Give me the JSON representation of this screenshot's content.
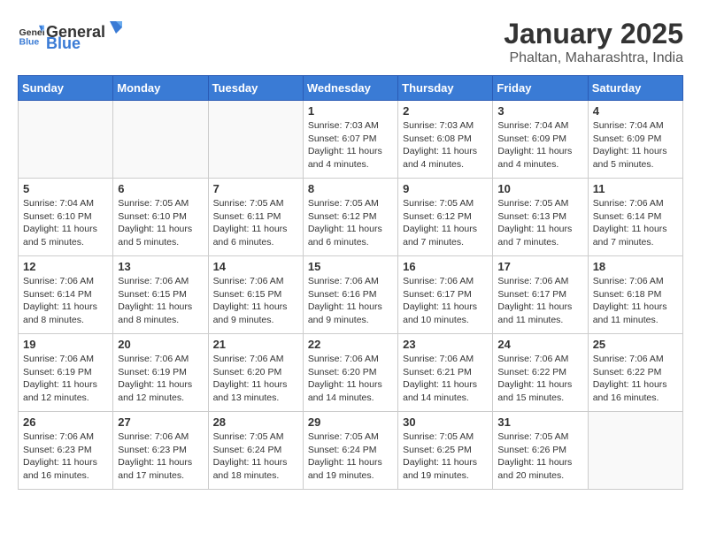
{
  "header": {
    "logo_general": "General",
    "logo_blue": "Blue",
    "month": "January 2025",
    "location": "Phaltan, Maharashtra, India"
  },
  "weekdays": [
    "Sunday",
    "Monday",
    "Tuesday",
    "Wednesday",
    "Thursday",
    "Friday",
    "Saturday"
  ],
  "weeks": [
    [
      {
        "day": "",
        "info": ""
      },
      {
        "day": "",
        "info": ""
      },
      {
        "day": "",
        "info": ""
      },
      {
        "day": "1",
        "info": "Sunrise: 7:03 AM\nSunset: 6:07 PM\nDaylight: 11 hours\nand 4 minutes."
      },
      {
        "day": "2",
        "info": "Sunrise: 7:03 AM\nSunset: 6:08 PM\nDaylight: 11 hours\nand 4 minutes."
      },
      {
        "day": "3",
        "info": "Sunrise: 7:04 AM\nSunset: 6:09 PM\nDaylight: 11 hours\nand 4 minutes."
      },
      {
        "day": "4",
        "info": "Sunrise: 7:04 AM\nSunset: 6:09 PM\nDaylight: 11 hours\nand 5 minutes."
      }
    ],
    [
      {
        "day": "5",
        "info": "Sunrise: 7:04 AM\nSunset: 6:10 PM\nDaylight: 11 hours\nand 5 minutes."
      },
      {
        "day": "6",
        "info": "Sunrise: 7:05 AM\nSunset: 6:10 PM\nDaylight: 11 hours\nand 5 minutes."
      },
      {
        "day": "7",
        "info": "Sunrise: 7:05 AM\nSunset: 6:11 PM\nDaylight: 11 hours\nand 6 minutes."
      },
      {
        "day": "8",
        "info": "Sunrise: 7:05 AM\nSunset: 6:12 PM\nDaylight: 11 hours\nand 6 minutes."
      },
      {
        "day": "9",
        "info": "Sunrise: 7:05 AM\nSunset: 6:12 PM\nDaylight: 11 hours\nand 7 minutes."
      },
      {
        "day": "10",
        "info": "Sunrise: 7:05 AM\nSunset: 6:13 PM\nDaylight: 11 hours\nand 7 minutes."
      },
      {
        "day": "11",
        "info": "Sunrise: 7:06 AM\nSunset: 6:14 PM\nDaylight: 11 hours\nand 7 minutes."
      }
    ],
    [
      {
        "day": "12",
        "info": "Sunrise: 7:06 AM\nSunset: 6:14 PM\nDaylight: 11 hours\nand 8 minutes."
      },
      {
        "day": "13",
        "info": "Sunrise: 7:06 AM\nSunset: 6:15 PM\nDaylight: 11 hours\nand 8 minutes."
      },
      {
        "day": "14",
        "info": "Sunrise: 7:06 AM\nSunset: 6:15 PM\nDaylight: 11 hours\nand 9 minutes."
      },
      {
        "day": "15",
        "info": "Sunrise: 7:06 AM\nSunset: 6:16 PM\nDaylight: 11 hours\nand 9 minutes."
      },
      {
        "day": "16",
        "info": "Sunrise: 7:06 AM\nSunset: 6:17 PM\nDaylight: 11 hours\nand 10 minutes."
      },
      {
        "day": "17",
        "info": "Sunrise: 7:06 AM\nSunset: 6:17 PM\nDaylight: 11 hours\nand 11 minutes."
      },
      {
        "day": "18",
        "info": "Sunrise: 7:06 AM\nSunset: 6:18 PM\nDaylight: 11 hours\nand 11 minutes."
      }
    ],
    [
      {
        "day": "19",
        "info": "Sunrise: 7:06 AM\nSunset: 6:19 PM\nDaylight: 11 hours\nand 12 minutes."
      },
      {
        "day": "20",
        "info": "Sunrise: 7:06 AM\nSunset: 6:19 PM\nDaylight: 11 hours\nand 12 minutes."
      },
      {
        "day": "21",
        "info": "Sunrise: 7:06 AM\nSunset: 6:20 PM\nDaylight: 11 hours\nand 13 minutes."
      },
      {
        "day": "22",
        "info": "Sunrise: 7:06 AM\nSunset: 6:20 PM\nDaylight: 11 hours\nand 14 minutes."
      },
      {
        "day": "23",
        "info": "Sunrise: 7:06 AM\nSunset: 6:21 PM\nDaylight: 11 hours\nand 14 minutes."
      },
      {
        "day": "24",
        "info": "Sunrise: 7:06 AM\nSunset: 6:22 PM\nDaylight: 11 hours\nand 15 minutes."
      },
      {
        "day": "25",
        "info": "Sunrise: 7:06 AM\nSunset: 6:22 PM\nDaylight: 11 hours\nand 16 minutes."
      }
    ],
    [
      {
        "day": "26",
        "info": "Sunrise: 7:06 AM\nSunset: 6:23 PM\nDaylight: 11 hours\nand 16 minutes."
      },
      {
        "day": "27",
        "info": "Sunrise: 7:06 AM\nSunset: 6:23 PM\nDaylight: 11 hours\nand 17 minutes."
      },
      {
        "day": "28",
        "info": "Sunrise: 7:05 AM\nSunset: 6:24 PM\nDaylight: 11 hours\nand 18 minutes."
      },
      {
        "day": "29",
        "info": "Sunrise: 7:05 AM\nSunset: 6:24 PM\nDaylight: 11 hours\nand 19 minutes."
      },
      {
        "day": "30",
        "info": "Sunrise: 7:05 AM\nSunset: 6:25 PM\nDaylight: 11 hours\nand 19 minutes."
      },
      {
        "day": "31",
        "info": "Sunrise: 7:05 AM\nSunset: 6:26 PM\nDaylight: 11 hours\nand 20 minutes."
      },
      {
        "day": "",
        "info": ""
      }
    ]
  ]
}
